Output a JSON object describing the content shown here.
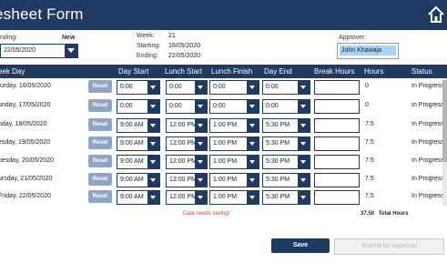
{
  "app": {
    "title": "esheet Form"
  },
  "top": {
    "ending_label": "nding:",
    "new_label": "New",
    "ending_value": "22/05/2020",
    "week_label": "Week:",
    "week_value": "21",
    "starting_label": "Starting:",
    "starting_value": "16/05/2020",
    "ending2_label": "Ending:",
    "ending2_value": "22/05/2020",
    "approver_label": "Approver:",
    "approver_value": "John Khawaja"
  },
  "table": {
    "headers": {
      "weekday": "eek Day",
      "daystart": "Day Start",
      "lunchstart": "Lunch Start",
      "lunchfinish": "Lunch Finish",
      "dayend": "Day End",
      "breakhours": "Break Hours",
      "hours": "Hours",
      "status": "Status"
    },
    "reset_label": "Reset",
    "rows": [
      {
        "day": "turday, 16/05/2020",
        "daystart": "0:00",
        "lunchstart": "0:00",
        "lunchfinish": "0:00",
        "dayend": "0:00",
        "hours": "0",
        "status": "In Progress"
      },
      {
        "day": "unday, 17/05/2020",
        "daystart": "0:00",
        "lunchstart": "0:00",
        "lunchfinish": "0:00",
        "dayend": "0:00",
        "hours": "0",
        "status": "In Progress"
      },
      {
        "day": "nday, 18/05/2020",
        "daystart": "9:00 AM",
        "lunchstart": "12:00 PM",
        "lunchfinish": "1:00 PM",
        "dayend": "5:30 PM",
        "hours": "7.5",
        "status": "In Progress"
      },
      {
        "day": "esday, 19/05/2020",
        "daystart": "9:00 AM",
        "lunchstart": "12:00 PM",
        "lunchfinish": "1:00 PM",
        "dayend": "5:30 PM",
        "hours": "7.5",
        "status": "In Progress"
      },
      {
        "day": "nesday, 20/05/2020",
        "daystart": "9:00 AM",
        "lunchstart": "12:00 PM",
        "lunchfinish": "1:00 PM",
        "dayend": "5:30 PM",
        "hours": "7.5",
        "status": "In Progress"
      },
      {
        "day": "ursday, 21/05/2020",
        "daystart": "9:00 AM",
        "lunchstart": "12:00 PM",
        "lunchfinish": "1:00 PM",
        "dayend": "5:30 PM",
        "hours": "7.5",
        "status": "In Progress"
      },
      {
        "day": "Friday, 22/05/2020",
        "daystart": "9:00 AM",
        "lunchstart": "12:00 PM",
        "lunchfinish": "1:00 PM",
        "dayend": "5:30 PM",
        "hours": "7.5",
        "status": "In Progress"
      }
    ]
  },
  "footer": {
    "message": "Data needs saving!",
    "total_value": "37.50",
    "total_label": "Total Hours",
    "save_label": "Save",
    "submit_label": "Submit for Approval"
  },
  "colors": {
    "primary": "#1f3b63",
    "accent": "#8ea6c4",
    "warning": "#d23b3b"
  },
  "icons": {
    "home": "home-icon",
    "dropdown": "chevron-down-icon"
  }
}
